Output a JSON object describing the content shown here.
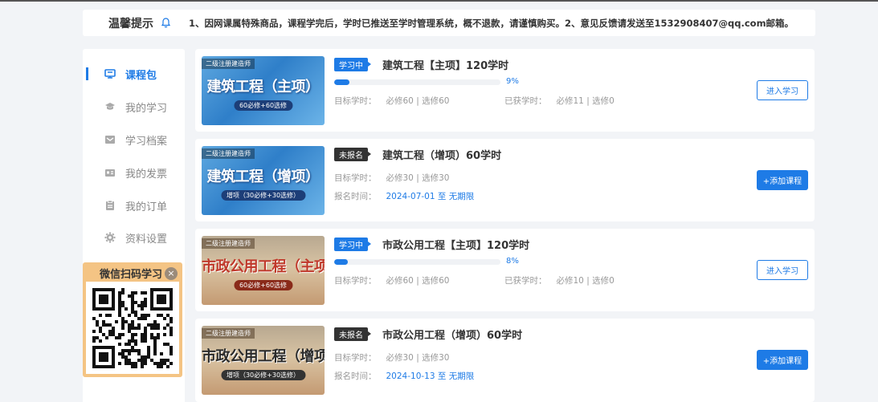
{
  "notice": {
    "title": "温馨提示",
    "text": "1、因网课属特殊商品，课程学完后，学时已推送至学时管理系统，概不退款，请谨慎购买。2、意见反馈请发送至1532908407@qq.com邮箱。"
  },
  "sidebar": {
    "items": [
      {
        "label": "课程包",
        "icon": "package-icon"
      },
      {
        "label": "我的学习",
        "icon": "graduation-cap-icon"
      },
      {
        "label": "学习档案",
        "icon": "archive-icon"
      },
      {
        "label": "我的发票",
        "icon": "invoice-icon"
      },
      {
        "label": "我的订单",
        "icon": "order-icon"
      },
      {
        "label": "资料设置",
        "icon": "gear-icon"
      }
    ],
    "active_index": 0
  },
  "qr": {
    "title": "微信扫码学习",
    "close": "×"
  },
  "courses": [
    {
      "thumb_tag": "二级注册建造师",
      "thumb_title": "建筑工程（主项）",
      "thumb_pill": "60必修+60选修",
      "status": "学习中",
      "name": "建筑工程【主项】120学时",
      "progress_label": "9%",
      "target_label": "目标学时：",
      "target_value": "必修60 | 选修60",
      "earned_label": "已获学时：",
      "earned_value": "必修11 | 选修0",
      "button": "进入学习"
    },
    {
      "thumb_tag": "二级注册建造师",
      "thumb_title": "建筑工程（增项）",
      "thumb_pill": "增项（30必修+30选修）",
      "status": "未报名",
      "name": "建筑工程（增项）60学时",
      "target_label": "目标学时：",
      "target_value": "必修30 | 选修30",
      "reg_label": "报名时间：",
      "reg_value": "2024-07-01 至 无期限",
      "button": "+添加课程"
    },
    {
      "thumb_tag": "二级注册建造师",
      "thumb_title": "市政公用工程（主项）",
      "thumb_pill": "60必修+60选修",
      "status": "学习中",
      "name": "市政公用工程【主项】120学时",
      "progress_label": "8%",
      "target_label": "目标学时：",
      "target_value": "必修60 | 选修60",
      "earned_label": "已获学时：",
      "earned_value": "必修10 | 选修0",
      "button": "进入学习"
    },
    {
      "thumb_tag": "二级注册建造师",
      "thumb_title": "市政公用工程（增项）",
      "thumb_pill": "增项（30必修+30选修）",
      "status": "未报名",
      "name": "市政公用工程（增项）60学时",
      "target_label": "目标学时：",
      "target_value": "必修30 | 选修30",
      "reg_label": "报名时间：",
      "reg_value": "2024-10-13 至 无期限",
      "button": "+添加课程"
    }
  ],
  "progress": [
    0.09,
    0.08
  ],
  "colors": {
    "accent": "#1e7be6",
    "qr_frame": "#f4c484",
    "unregistered": "#333333"
  }
}
